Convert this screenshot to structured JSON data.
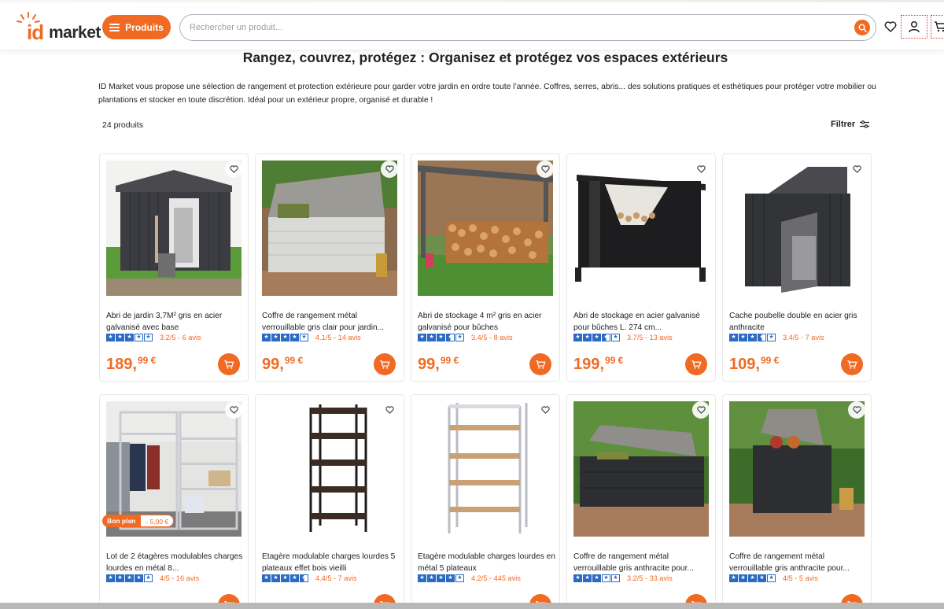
{
  "header": {
    "logo_id": "id",
    "logo_market": "market",
    "menu_label": "Produits",
    "search_placeholder": "Rechercher un produit..."
  },
  "page": {
    "title": "Rangez, couvrez, protégez : Organisez et protégez vos espaces extérieurs",
    "intro": "ID Market vous propose une sélection de rangement et protection extérieure pour garder votre jardin en ordre toute l’année.  Coffres, serres, abris... des solutions pratiques et esthétiques pour protéger votre mobilier ou plantations et stocker en toute discrétion. Idéal pour un extérieur propre, organisé et durable !",
    "count": "24 produits",
    "filter_label": "Filtrer"
  },
  "products": [
    {
      "name": "Abri de jardin 3,7M² gris en acier galvanisé avec base",
      "rating": 3.2,
      "rating_text": "3.2/5 - 6 avis",
      "price_int": "189,",
      "price_dec": "99 €"
    },
    {
      "name": "Coffre de rangement métal verrouillable gris clair pour jardin...",
      "rating": 4.1,
      "rating_text": "4.1/5 - 14 avis",
      "price_int": "99,",
      "price_dec": "99 €"
    },
    {
      "name": "Abri de stockage 4 m² gris en acier galvanisé pour bûches",
      "rating": 3.4,
      "rating_text": "3.4/5 - 8 avis",
      "price_int": "99,",
      "price_dec": "99 €"
    },
    {
      "name": "Abri de stockage en acier galvanisé pour bûches L. 274 cm...",
      "rating": 3.7,
      "rating_text": "3.7/5 - 13 avis",
      "price_int": "199,",
      "price_dec": "99 €"
    },
    {
      "name": "Cache poubelle double en acier gris anthracite",
      "rating": 3.4,
      "rating_text": "3.4/5 - 7 avis",
      "price_int": "109,",
      "price_dec": "99 €"
    },
    {
      "name": "Lot de 2 étagères modulables charges lourdes en métal 8...",
      "rating": 4,
      "rating_text": "4/5 - 16 avis",
      "badge_label": "Bon plan",
      "badge_value": "- 5,00 €"
    },
    {
      "name": "Etagère modulable charges lourdes 5 plateaux effet bois vieilli",
      "rating": 4.4,
      "rating_text": "4.4/5 - 7 avis"
    },
    {
      "name": "Etagère modulable charges lourdes en métal 5 plateaux",
      "rating": 4.2,
      "rating_text": "4.2/5 - 445 avis"
    },
    {
      "name": "Coffre de rangement métal verrouillable gris anthracite pour...",
      "rating": 3.2,
      "rating_text": "3.2/5 - 33 avis"
    },
    {
      "name": "Coffre de rangement métal verrouillable gris anthracite pour...",
      "rating": 4,
      "rating_text": "4/5 - 5 avis"
    }
  ],
  "colors": {
    "accent": "#f06a23",
    "star": "#2b6bc4"
  },
  "icons": [
    "menu-icon",
    "search-icon",
    "heart-icon",
    "user-icon",
    "cart-icon",
    "filter-icon",
    "star-icon"
  ]
}
